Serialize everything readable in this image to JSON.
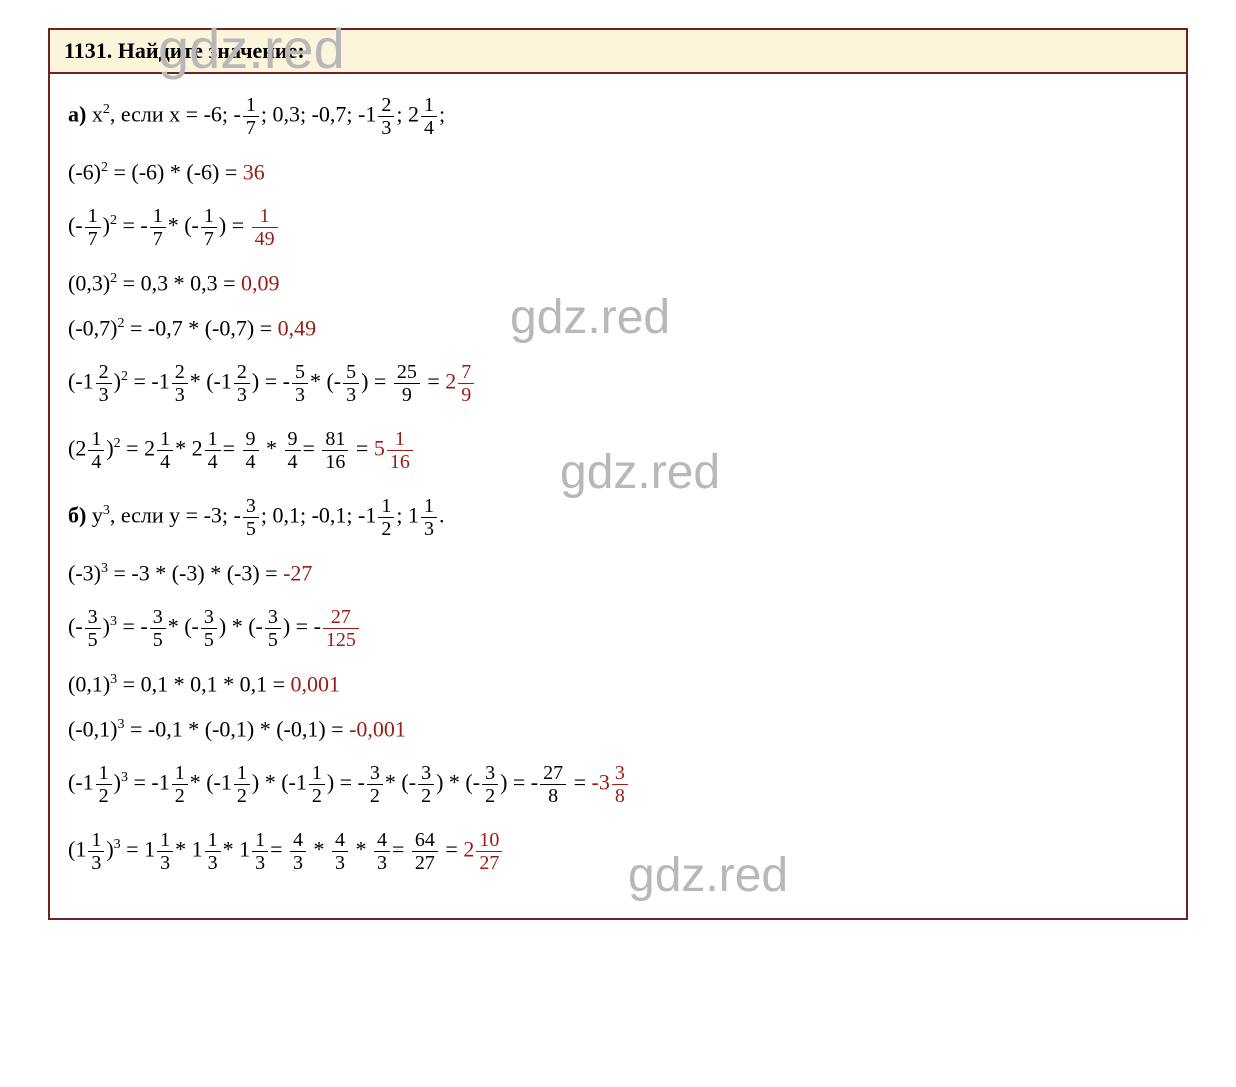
{
  "watermark": "gdz.red",
  "header": "1131. Найдите значение:",
  "partA": {
    "label": "а)",
    "prompt_pre": " x",
    "prompt_exp": "2",
    "prompt_mid": ", если x = -6;  -",
    "f1n": "1",
    "f1d": "7",
    "prompt_mid2": "; 0,3; -0,7; -1",
    "f2n": "2",
    "f2d": "3",
    "prompt_mid3": "; 2",
    "f3n": "1",
    "f3d": "4",
    "prompt_end": ";",
    "line1_a": "(-6)",
    "line1_exp": "2",
    "line1_b": " = (-6) * (-6) = ",
    "line1_ans": "36",
    "line2_a": "(-",
    "line2_f1n": "1",
    "line2_f1d": "7",
    "line2_b": ")",
    "line2_exp": "2",
    "line2_c": "  =  -",
    "line2_f2n": "1",
    "line2_f2d": "7",
    "line2_d": "* (-",
    "line2_f3n": "1",
    "line2_f3d": "7",
    "line2_e": ")  =  ",
    "line2_ansn": "1",
    "line2_ansd": "49",
    "line3_a": "(0,3)",
    "line3_exp": "2",
    "line3_b": " = 0,3 * 0,3 = ",
    "line3_ans": "0,09",
    "line4_a": "(-0,7)",
    "line4_exp": "2",
    "line4_b": " = -0,7 * (-0,7) = ",
    "line4_ans": "0,49",
    "line5_a": "(-1",
    "line5_f1n": "2",
    "line5_f1d": "3",
    "line5_b": ")",
    "line5_exp": "2",
    "line5_c": " = -1",
    "line5_f2n": "2",
    "line5_f2d": "3",
    "line5_d": "* (-1",
    "line5_f3n": "2",
    "line5_f3d": "3",
    "line5_e": ")  =  -",
    "line5_f4n": "5",
    "line5_f4d": "3",
    "line5_f": "* (-",
    "line5_f5n": "5",
    "line5_f5d": "3",
    "line5_g": ")  =  ",
    "line5_f6n": "25",
    "line5_f6d": "9",
    "line5_eq": " =",
    "line5_ans_int": " 2",
    "line5_ansn": "7",
    "line5_ansd": "9",
    "line6_a": "(2",
    "line6_f1n": "1",
    "line6_f1d": "4",
    "line6_b": ")",
    "line6_exp": "2",
    "line6_c": "  =  2",
    "line6_f2n": "1",
    "line6_f2d": "4",
    "line6_d": "*  2",
    "line6_f3n": "1",
    "line6_f3d": "4",
    "line6_e": "=  ",
    "line6_f4n": "9",
    "line6_f4d": "4",
    "line6_f": " * ",
    "line6_f5n": "9",
    "line6_f5d": "4",
    "line6_g": "=  ",
    "line6_f6n": "81",
    "line6_f6d": "16",
    "line6_eq": " =",
    "line6_ans_int": " 5",
    "line6_ansn": "1",
    "line6_ansd": "16"
  },
  "partB": {
    "label": "б)",
    "prompt_pre": " y",
    "prompt_exp": "3",
    "prompt_mid": ", если y = -3;  -",
    "f1n": "3",
    "f1d": "5",
    "prompt_mid2": "; 0,1; -0,1; -1",
    "f2n": "1",
    "f2d": "2",
    "prompt_mid3": "; 1",
    "f3n": "1",
    "f3d": "3",
    "prompt_end": ".",
    "line1_a": "(-3)",
    "line1_exp": "3",
    "line1_b": " = -3 * (-3) * (-3) = ",
    "line1_ans": "-27",
    "line2_a": "(-",
    "line2_f1n": "3",
    "line2_f1d": "5",
    "line2_b": ")",
    "line2_exp": "3",
    "line2_c": "  =  -",
    "line2_f2n": "3",
    "line2_f2d": "5",
    "line2_d": "* (-",
    "line2_f3n": "3",
    "line2_f3d": "5",
    "line2_e": ") * (-",
    "line2_f4n": "3",
    "line2_f4d": "5",
    "line2_f": ")  =  -",
    "line2_ansn": "27",
    "line2_ansd": "125",
    "line3_a": "(0,1)",
    "line3_exp": "3",
    "line3_b": " = 0,1 * 0,1 * 0,1 = ",
    "line3_ans": "0,001",
    "line4_a": "(-0,1)",
    "line4_exp": "3",
    "line4_b": " = -0,1 * (-0,1) * (-0,1) = ",
    "line4_ans": "-0,001",
    "line5_a": "(-1",
    "line5_f1n": "1",
    "line5_f1d": "2",
    "line5_b": ")",
    "line5_exp": "3",
    "line5_c": " = -1",
    "line5_f2n": "1",
    "line5_f2d": "2",
    "line5_d": "* (-1",
    "line5_f3n": "1",
    "line5_f3d": "2",
    "line5_e": ") * (-1",
    "line5_f4n": "1",
    "line5_f4d": "2",
    "line5_f": ")  =  -",
    "line5_f5n": "3",
    "line5_f5d": "2",
    "line5_g": "* (-",
    "line5_f6n": "3",
    "line5_f6d": "2",
    "line5_h": ") * (-",
    "line5_f7n": "3",
    "line5_f7d": "2",
    "line5_i": ")  =  -",
    "line5_f8n": "27",
    "line5_f8d": "8",
    "line5_eq": " =",
    "line5_ans_int": " -3",
    "line5_ansn": "3",
    "line5_ansd": "8",
    "line6_a": "(1",
    "line6_f1n": "1",
    "line6_f1d": "3",
    "line6_b": ")",
    "line6_exp": "3",
    "line6_c": "  =  1",
    "line6_f2n": "1",
    "line6_f2d": "3",
    "line6_d": "*  1",
    "line6_f3n": "1",
    "line6_f3d": "3",
    "line6_e": "*  1",
    "line6_f4n": "1",
    "line6_f4d": "3",
    "line6_f": "=  ",
    "line6_f5n": "4",
    "line6_f5d": "3",
    "line6_g": " * ",
    "line6_f6n": "4",
    "line6_f6d": "3",
    "line6_h": " * ",
    "line6_f7n": "4",
    "line6_f7d": "3",
    "line6_i": "=  ",
    "line6_f8n": "64",
    "line6_f8d": "27",
    "line6_eq": " =",
    "line6_ans_int": " 2",
    "line6_ansn": "10",
    "line6_ansd": "27"
  }
}
